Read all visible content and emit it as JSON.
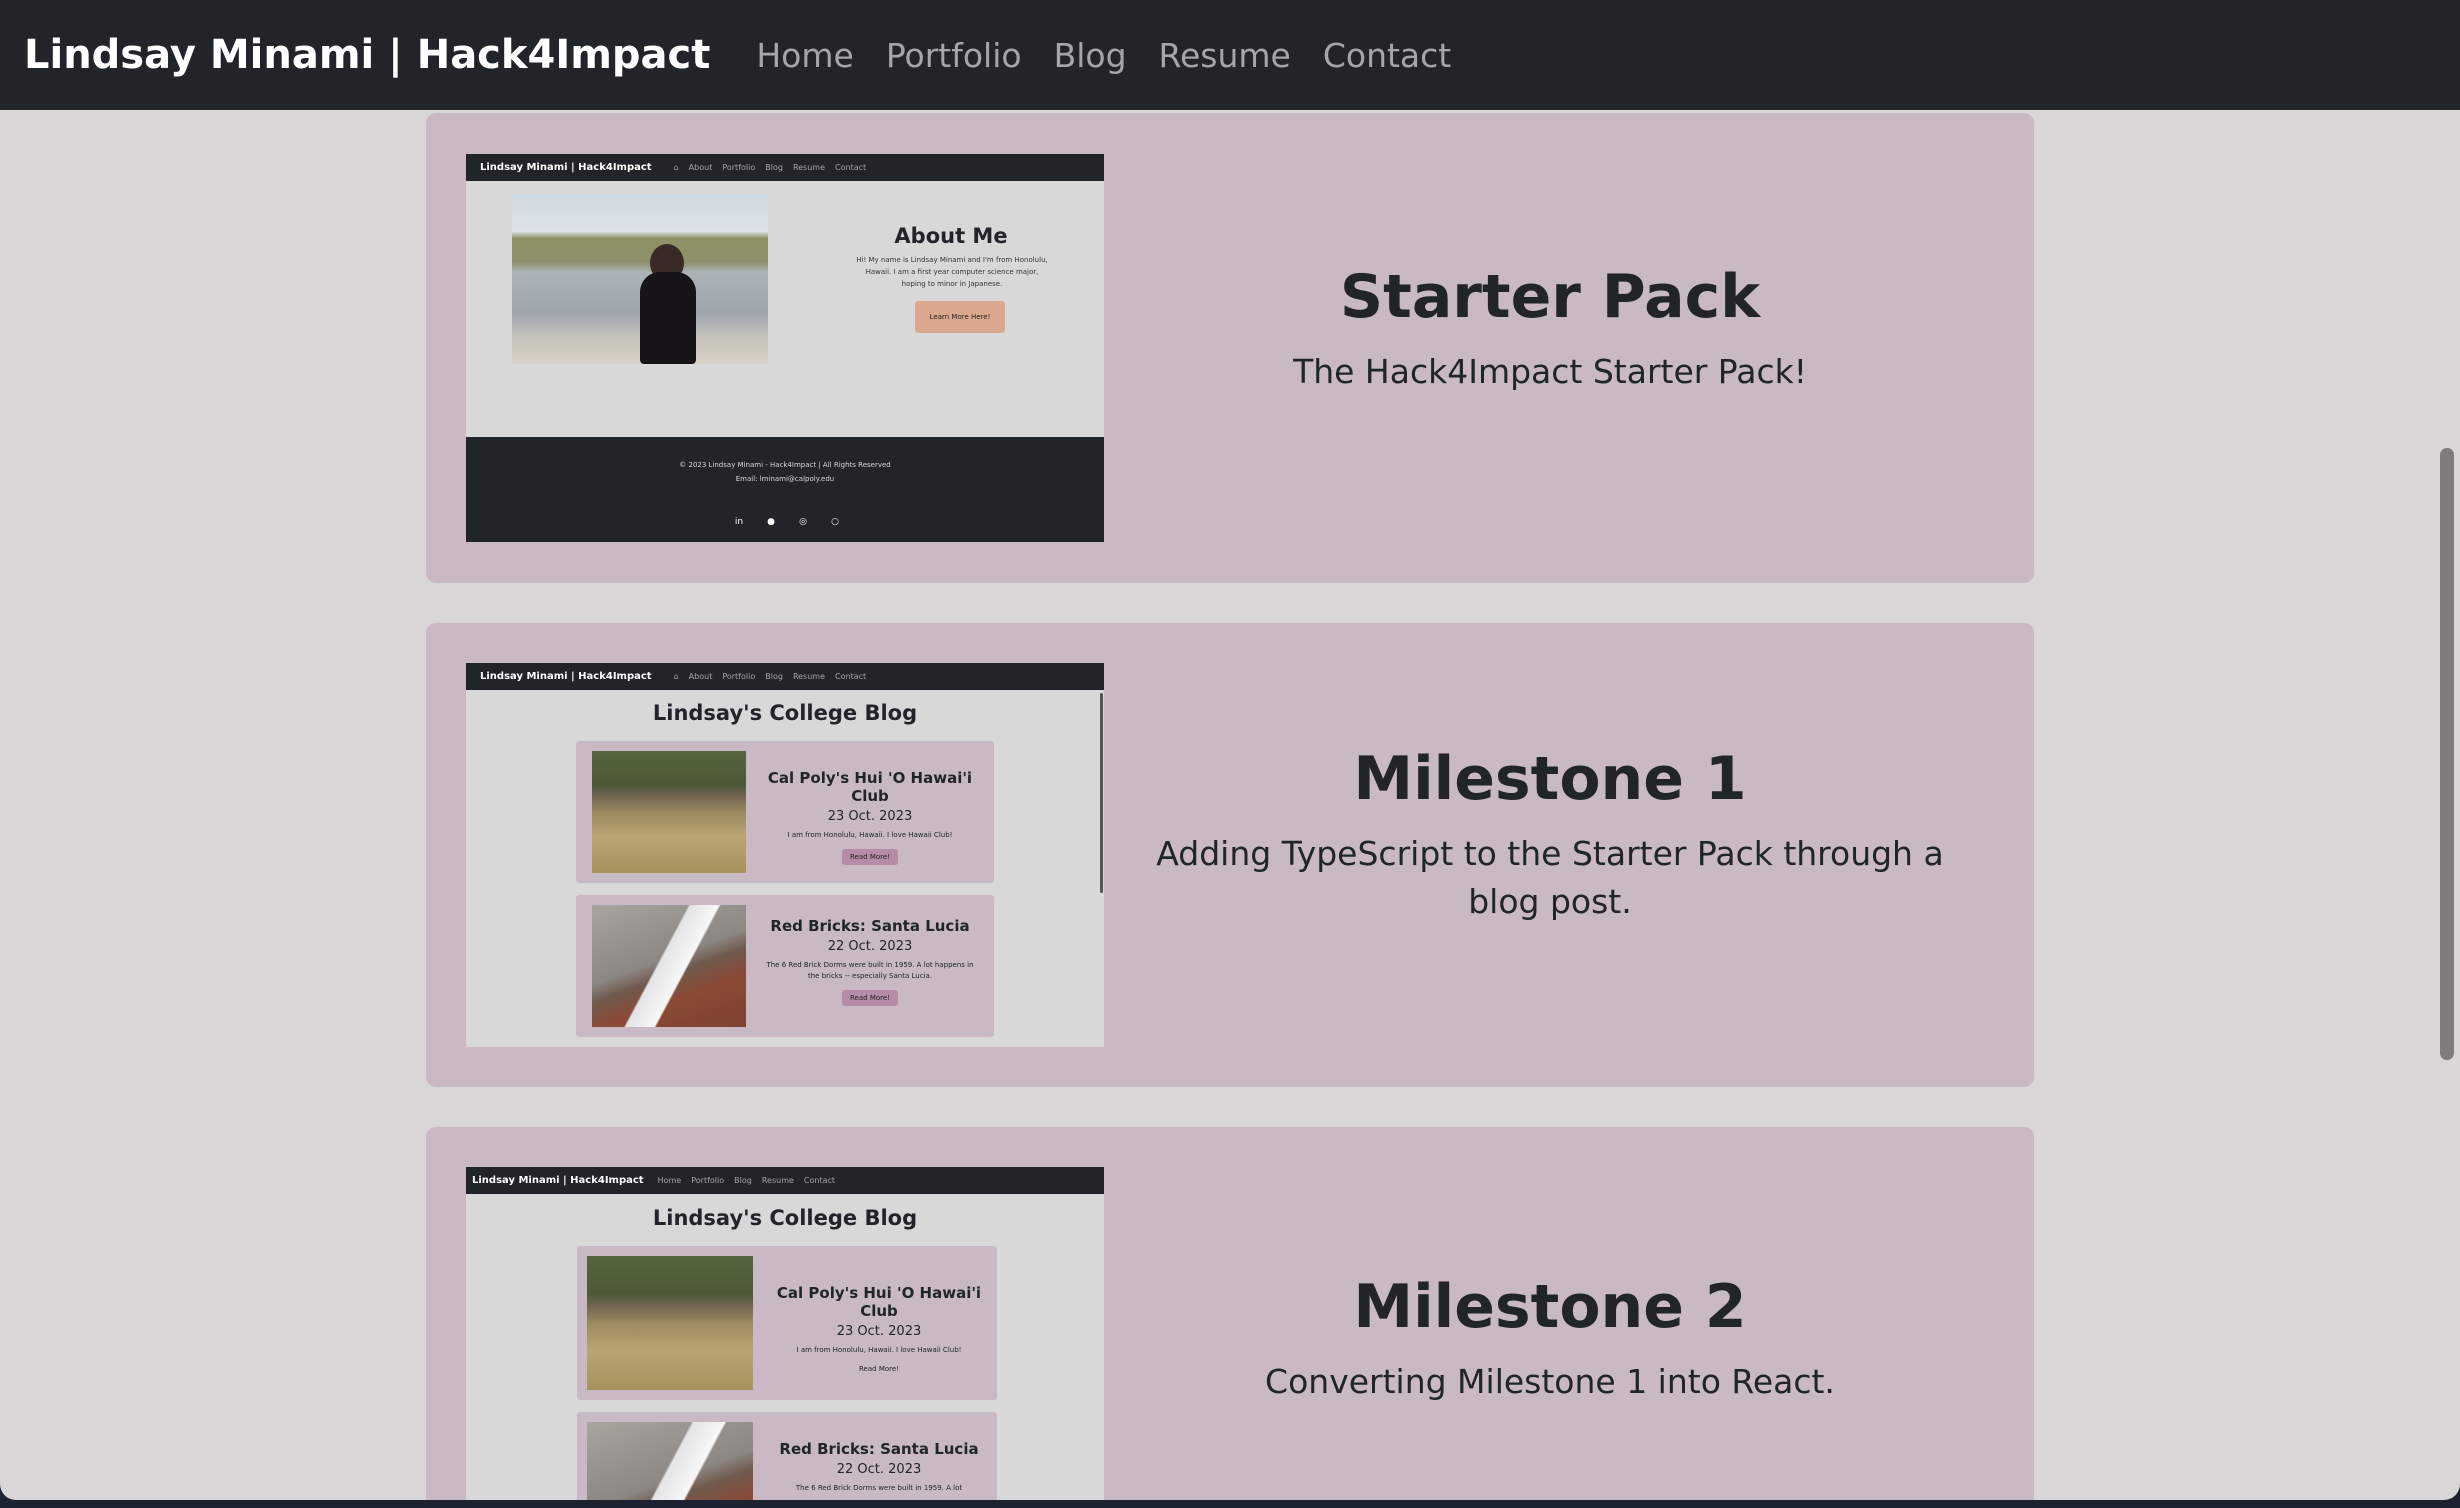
{
  "navbar": {
    "brand": "Lindsay Minami | Hack4Impact",
    "links": [
      "Home",
      "Portfolio",
      "Blog",
      "Resume",
      "Contact"
    ]
  },
  "cards": [
    {
      "title": "Starter Pack",
      "subtitle": "The Hack4Impact Starter Pack!",
      "thumbnail": {
        "brand": "Lindsay Minami | Hack4Impact",
        "links": [
          "About",
          "Portfolio",
          "Blog",
          "Resume",
          "Contact"
        ],
        "heading": "About Me",
        "paragraph": "Hi! My name is Lindsay Minami and I'm from Honolulu, Hawaii. I am a first year computer science major, hoping to minor in Japanese.",
        "button": "Learn More Here!",
        "footer_copy": "© 2023 Lindsay Minami - Hack4Impact | All Rights Reserved",
        "footer_email": "Email: lminami@calpoly.edu"
      }
    },
    {
      "title": "Milestone 1",
      "subtitle": "Adding TypeScript to the Starter Pack through a blog post.",
      "thumbnail": {
        "brand": "Lindsay Minami | Hack4Impact",
        "links": [
          "About",
          "Portfolio",
          "Blog",
          "Resume",
          "Contact"
        ],
        "blog_title": "Lindsay's College Blog",
        "posts": [
          {
            "title": "Cal Poly's Hui 'O Hawai'i Club",
            "date": "23 Oct. 2023",
            "desc": "I am from Honolulu, Hawaii. I love Hawaii Club!",
            "button": "Read More!"
          },
          {
            "title": "Red Bricks: Santa Lucia",
            "date": "22 Oct. 2023",
            "desc": "The 6 Red Brick Dorms were built in 1959. A lot happens in the bricks -- especially Santa Lucia.",
            "button": "Read More!"
          }
        ]
      }
    },
    {
      "title": "Milestone 2",
      "subtitle": "Converting Milestone 1 into React.",
      "thumbnail": {
        "brand": "Lindsay Minami | Hack4Impact",
        "links": [
          "Home",
          "Portfolio",
          "Blog",
          "Resume",
          "Contact"
        ],
        "blog_title": "Lindsay's College Blog",
        "posts": [
          {
            "title": "Cal Poly's Hui 'O Hawai'i Club",
            "date": "23 Oct. 2023",
            "desc": "I am from Honolulu, Hawaii. I love Hawaii Club!",
            "button": "Read More!"
          },
          {
            "title": "Red Bricks: Santa Lucia",
            "date": "22 Oct. 2023",
            "desc": "The 6 Red Brick Dorms were built in 1959. A lot"
          }
        ]
      }
    }
  ]
}
